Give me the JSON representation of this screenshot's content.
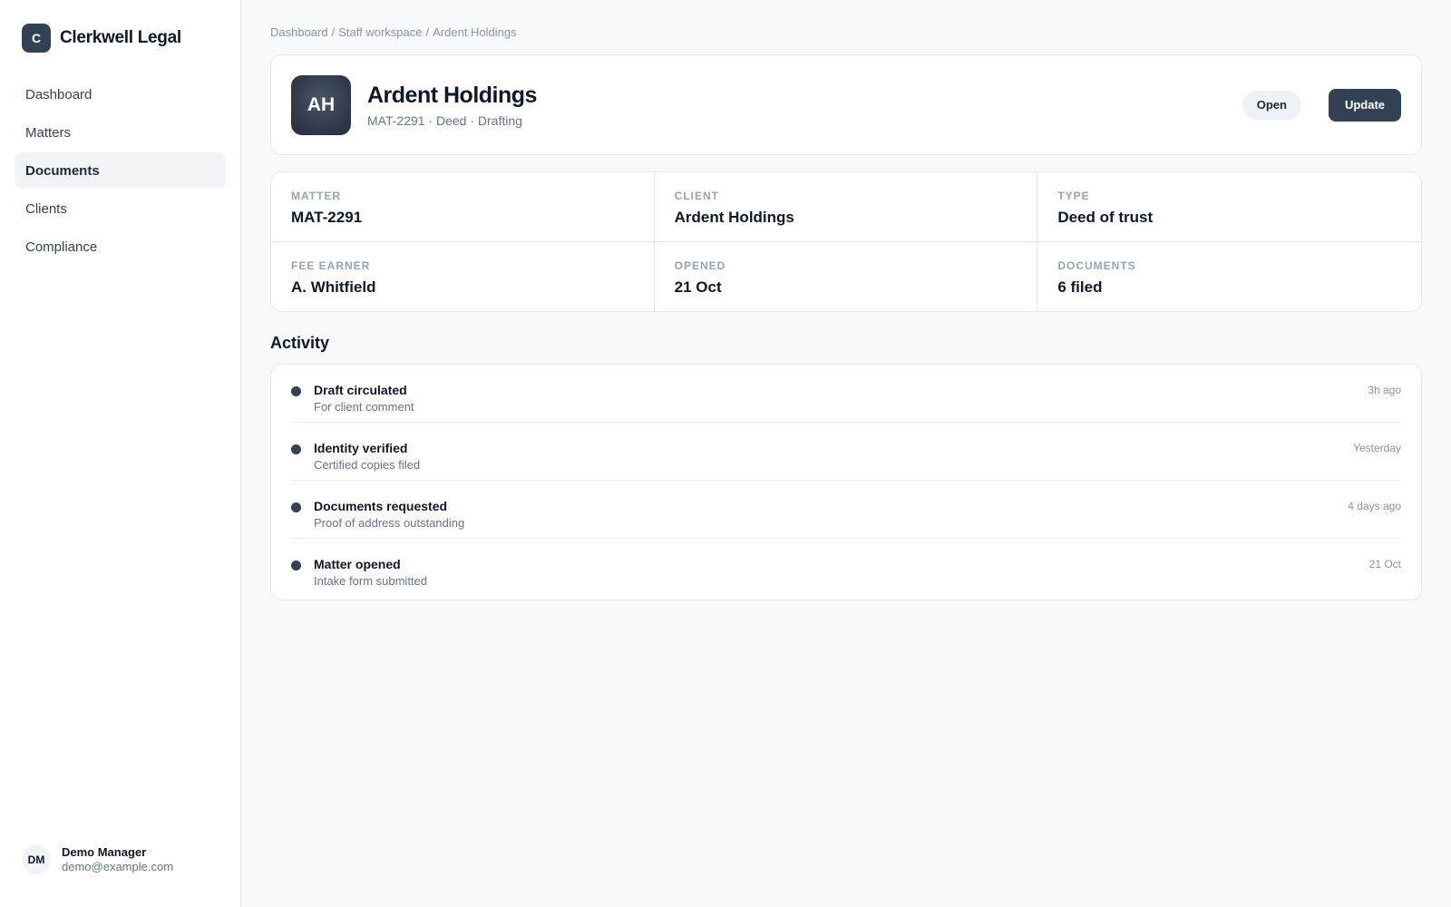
{
  "brand": {
    "mark": "C",
    "name": "Clerkwell Legal"
  },
  "nav": {
    "items": [
      {
        "label": "Dashboard"
      },
      {
        "label": "Matters"
      },
      {
        "label": "Documents",
        "active": true
      },
      {
        "label": "Clients"
      },
      {
        "label": "Compliance"
      }
    ]
  },
  "user": {
    "initials": "DM",
    "name": "Demo Manager",
    "email": "demo@example.com"
  },
  "breadcrumb": [
    "Dashboard",
    "Staff workspace",
    "Ardent Holdings"
  ],
  "header": {
    "initials": "AH",
    "title": "Ardent Holdings",
    "subtitle": "MAT-2291 · Deed · Drafting",
    "status_label": "Open",
    "update_label": "Update"
  },
  "details": [
    {
      "label": "Matter",
      "value": "MAT-2291"
    },
    {
      "label": "Client",
      "value": "Ardent Holdings"
    },
    {
      "label": "Type",
      "value": "Deed of trust"
    },
    {
      "label": "Fee earner",
      "value": "A. Whitfield"
    },
    {
      "label": "Opened",
      "value": "21 Oct"
    },
    {
      "label": "Documents",
      "value": "6 filed"
    }
  ],
  "activity": {
    "title": "Activity",
    "items": [
      {
        "title": "Draft circulated",
        "subtitle": "For client comment",
        "time": "3h ago"
      },
      {
        "title": "Identity verified",
        "subtitle": "Certified copies filed",
        "time": "Yesterday"
      },
      {
        "title": "Documents requested",
        "subtitle": "Proof of address outstanding",
        "time": "4 days ago"
      },
      {
        "title": "Matter opened",
        "subtitle": "Intake form submitted",
        "time": "21 Oct"
      }
    ]
  },
  "colors": {
    "accent": "#334155",
    "background": "#f8f9fb",
    "border": "#e5e7eb"
  }
}
